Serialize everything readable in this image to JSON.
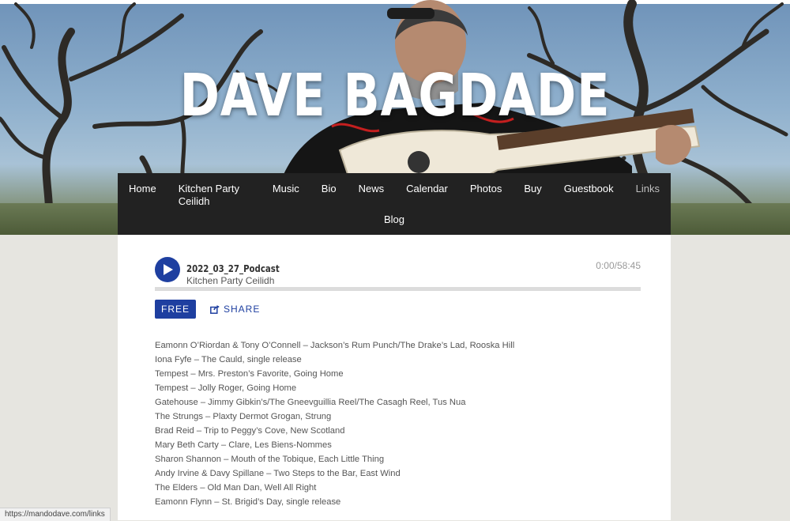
{
  "site": {
    "title": "DAVE BAGDADE"
  },
  "nav": {
    "row1": [
      "Home",
      "Kitchen Party Ceilidh",
      "Music",
      "Bio",
      "News",
      "Calendar",
      "Photos",
      "Buy",
      "Guestbook",
      "Links"
    ],
    "row2": [
      "Blog"
    ],
    "active": "Links"
  },
  "player": {
    "title": "2022_03_27_Podcast",
    "subtitle": "Kitchen Party Ceilidh",
    "time": "0:00/58:45",
    "progress": 0,
    "play_icon": "play-icon",
    "free_label": "FREE",
    "share_label": "SHARE",
    "share_icon": "share-icon"
  },
  "tracks": [
    "Eamonn O’Riordan & Tony O’Connell – Jackson’s Rum Punch/The Drake’s Lad, Rooska Hill",
    "Iona Fyfe – The Cauld, single release",
    "Tempest – Mrs. Preston’s Favorite, Going Home",
    "Tempest – Jolly Roger, Going Home",
    "Gatehouse – Jimmy Gibkin’s/The Gneevguillia Reel/The Casagh Reel, Tus Nua",
    "The Strungs – Plaxty Dermot Grogan, Strung",
    "Brad Reid – Trip to Peggy’s Cove, New Scotland",
    "Mary Beth Carty – Clare, Les Biens-Nommes",
    "Sharon Shannon – Mouth of the Tobique, Each Little Thing",
    "Andy Irvine & Davy Spillane – Two Steps to the Bar, East Wind",
    "The Elders – Old Man Dan, Well All Right",
    "Eamonn Flynn – St. Brigid’s Day, single release"
  ],
  "statusbar": {
    "url": "https://mandodave.com/links"
  },
  "colors": {
    "accent": "#1e3fa0",
    "nav_bg": "#222222",
    "page_bg": "#e6e5e0"
  }
}
